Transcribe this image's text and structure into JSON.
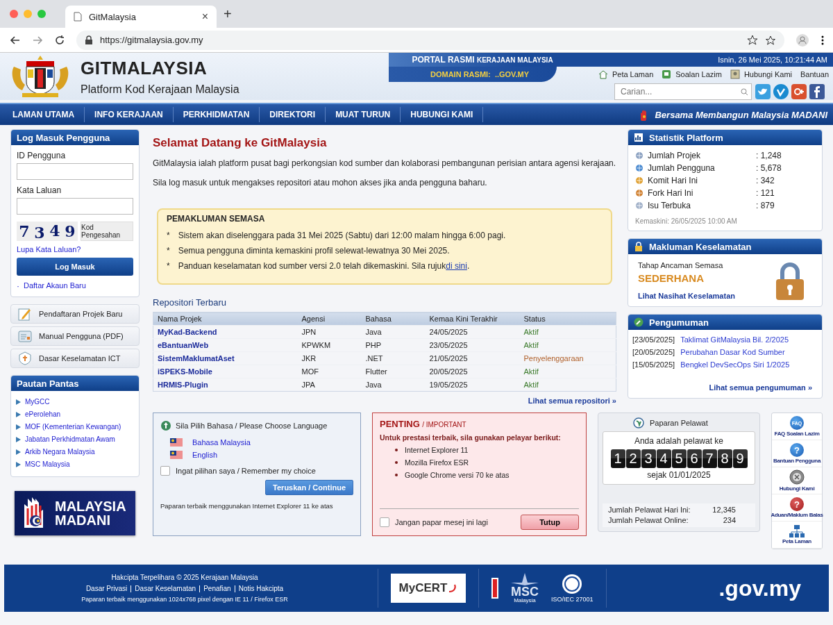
{
  "browser": {
    "tab_title": "GitMalaysia",
    "close": "×",
    "new_tab": "+",
    "url": "https://gitmalaysia.gov.my"
  },
  "header": {
    "title": "GITMALAYSIA",
    "subtitle": "Platform Kod Kerajaan Malaysia",
    "portal": "PORTAL RASMI",
    "portal_sub": "KERAJAAN MALAYSIA",
    "domain": "DOMAIN RASMI:  ..GOV.MY",
    "datetime": "Isnin, 26 Mei 2025, 10:21:44 AM",
    "top_links": [
      {
        "label": "Peta Laman",
        "kind": "home"
      },
      {
        "label": "Soalan Lazim",
        "kind": "faq"
      },
      {
        "label": "Hubungi Kami",
        "kind": "contact"
      },
      {
        "label": "Bantuan",
        "kind": "plain"
      }
    ],
    "search": {
      "placeholder": "Carian..."
    }
  },
  "nav": {
    "items": [
      "LAMAN UTAMA",
      "INFO KERAJAAN",
      "PERKHIDMATAN",
      "DIREKTORI",
      "MUAT TURUN",
      "HUBUNGI KAMI"
    ],
    "slogan": "Bersama Membangun Malaysia MADANI"
  },
  "login": {
    "title": "Log Masuk Pengguna",
    "fields": [
      {
        "label": "ID Pengguna"
      },
      {
        "label": "Kata Laluan"
      }
    ],
    "captcha": [
      "7",
      "3",
      "4",
      "9"
    ],
    "captcha_label": "Kod Pengesahan",
    "forgot": "Lupa Kata Laluan?",
    "button": "Log Masuk",
    "register_bullet": "·",
    "register": "Daftar Akaun Baru"
  },
  "side_buttons": [
    {
      "label": "Pendaftaran Projek Baru",
      "kind": "pencil"
    },
    {
      "label": "Manual Pengguna (PDF)",
      "kind": "manual"
    },
    {
      "label": "Dasar Keselamatan ICT",
      "kind": "shield"
    }
  ],
  "quick_links": {
    "title": "Pautan Pantas",
    "items": [
      "MyGCC",
      "ePerolehan",
      "MOF (Kementerian Kewangan)",
      "Jabatan Perkhidmatan Awam",
      "Arkib Negara Malaysia",
      "MSC Malaysia"
    ]
  },
  "banner": {
    "lines": [
      "MALAYSIA",
      "MADANI"
    ]
  },
  "welcome": {
    "title": "Selamat Datang ke GitMalaysia",
    "paragraphs": [
      "GitMalaysia ialah platform pusat bagi perkongsian kod sumber dan kolaborasi pembangunan perisian antara agensi kerajaan.",
      "Sila log masuk untuk mengakses repositori atau mohon akses jika anda pengguna baharu."
    ]
  },
  "notice": {
    "title": "PEMAKLUMAN SEMASA",
    "bullet": "*",
    "items": [
      {
        "text": "Sistem akan diselenggara pada 31 Mei 2025 (Sabtu) dari 12:00 malam hingga 6:00 pagi."
      },
      {
        "text": "Semua pengguna diminta kemaskini profil selewat-lewatnya 30 Mei 2025."
      },
      {
        "text": "Panduan keselamatan kod sumber versi 2.0 telah dikemaskini. Sila rujuk",
        "link": "di sini",
        "tail": "."
      }
    ]
  },
  "repos": {
    "title": "Repositori Terbaru",
    "columns": [
      "Nama Projek",
      "Agensi",
      "Bahasa",
      "Kemaa Kini Terakhir",
      "Status"
    ],
    "rows": [
      {
        "name": "MyKad-Backend",
        "agency": "JPN",
        "language": "Java",
        "updated": "24/05/2025",
        "status": "Aktif",
        "color": "#3a7a2a"
      },
      {
        "name": "eBantuanWeb",
        "agency": "KPWKM",
        "language": "PHP",
        "updated": "23/05/2025",
        "status": "Aktif",
        "color": "#3a7a2a"
      },
      {
        "name": "SistemMaklumatAset",
        "agency": "JKR",
        "language": ".NET",
        "updated": "21/05/2025",
        "status": "Penyelenggaraan",
        "color": "#b0602a"
      },
      {
        "name": "iSPEKS-Mobile",
        "agency": "MOF",
        "language": "Flutter",
        "updated": "20/05/2025",
        "status": "Aktif",
        "color": "#3a7a2a"
      },
      {
        "name": "HRMIS-Plugin",
        "agency": "JPA",
        "language": "Java",
        "updated": "19/05/2025",
        "status": "Aktif",
        "color": "#3a7a2a"
      }
    ],
    "view_all": "Lihat semua repositori »"
  },
  "language": {
    "title": "Sila Pilih Bahasa / Please Choose Language",
    "options": [
      "Bahasa Malaysia",
      "English"
    ],
    "remember": {
      "label": "Ingat pilihan saya / Remember my choice",
      "checked": false
    },
    "button": "Teruskan / Continue",
    "note": "Paparan terbaik menggunakan Internet Explorer 11 ke atas"
  },
  "important": {
    "title": "PENTING",
    "subtitle": "/ IMPORTANT",
    "intro": "Untuk prestasi terbaik, sila gunakan pelayar berikut:",
    "items": [
      "Internet Explorer 11",
      "Mozilla Firefox ESR",
      "Google Chrome versi 70 ke atas"
    ],
    "dont_show": {
      "label": "Jangan papar mesej ini lagi",
      "checked": false
    },
    "button": "Tutup"
  },
  "stats": {
    "title": "Statistik Platform",
    "items": [
      {
        "label": "Jumlah Projek",
        "value": ": 1,248"
      },
      {
        "label": "Jumlah Pengguna",
        "value": ": 5,678"
      },
      {
        "label": "Komit Hari Ini",
        "value": ": 342"
      },
      {
        "label": "Fork Hari Ini",
        "value": ": 121"
      },
      {
        "label": "Isu Terbuka",
        "value": ": 879"
      }
    ],
    "updated": "Kemaskini: 26/05/2025 10:00 AM"
  },
  "security": {
    "title": "Makluman Keselamatan",
    "level_label": "Tahap Ancaman Semasa",
    "level": "SEDERHANA",
    "link": "Lihat Nasihat Keselamatan"
  },
  "announcements": {
    "title": "Pengumuman",
    "items": [
      {
        "date": "[23/05/2025]",
        "title": "Taklimat GitMalaysia Bil. 2/2025"
      },
      {
        "date": "[20/05/2025]",
        "title": "Perubahan Dasar Kod Sumber"
      },
      {
        "date": "[15/05/2025]",
        "title": "Bengkel DevSecOps Siri 1/2025"
      }
    ],
    "view_all": "Lihat semua pengumuman »"
  },
  "visitor": {
    "title": "Paparan Pelawat",
    "caption": "Anda adalah pelawat ke",
    "digits": [
      "1",
      "2",
      "3",
      "4",
      "5",
      "6",
      "7",
      "8",
      "9"
    ],
    "since": "sejak 01/01/2025",
    "rows": [
      {
        "label": "Jumlah Pelawat Hari Ini:",
        "value": "12,345"
      },
      {
        "label": "Jumlah Pelawat Online:",
        "value": "234"
      }
    ]
  },
  "side_icons": [
    {
      "label": "FAQ Soalan Lazim",
      "kind": "faq",
      "glyph": "FAQ"
    },
    {
      "label": "Bantuan Pengguna",
      "kind": "help",
      "glyph": "?"
    },
    {
      "label": "Hubungi Kami",
      "kind": "contact"
    },
    {
      "label": "Aduan/Maklum Balas",
      "kind": "feedback",
      "glyph": "?"
    },
    {
      "label": "Peta Laman",
      "kind": "sitemap"
    }
  ],
  "footer": {
    "copyright": "Hakcipta Terpelihara © 2025 Kerajaan Malaysia",
    "links": [
      "Dasar Privasi",
      "Dasar Keselamatan",
      "Penafian",
      "Notis Hakcipta"
    ],
    "note": "Paparan terbaik menggunakan 1024x768 pixel dengan IE 11 / Firefox ESR",
    "mycert": "MyCERT",
    "msc": "MSC",
    "msc_sub": "Malaysia",
    "iso": "ISO/IEC 27001",
    "domain": ".gov.my"
  }
}
